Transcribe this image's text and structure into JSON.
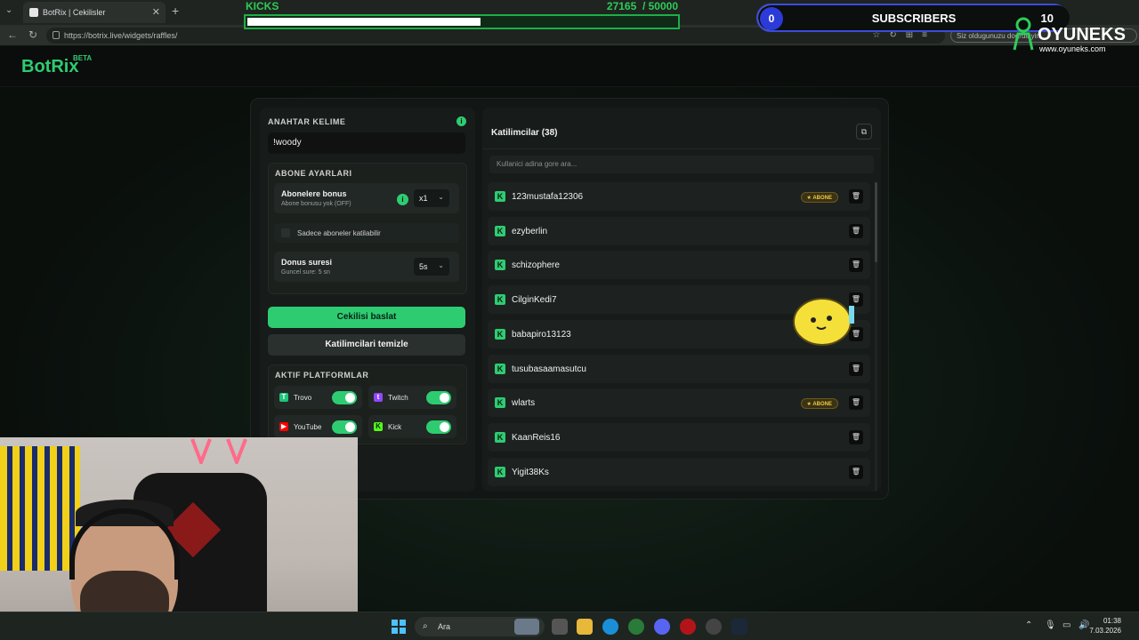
{
  "browser": {
    "tab_title": "BotRix | Cekilisler",
    "new_tab": "+",
    "close": "✕",
    "url": "https://botrix.live/widgets/raffles/",
    "signin_notice": "Siz oldugunuzu dogrulayin..."
  },
  "overlay": {
    "kicks_label": "KICKS",
    "kicks_count": "27165",
    "kicks_goal": "/ 50000",
    "kicks_progress": 0.54,
    "subs_count": "0",
    "subs_label": "SUBSCRIBERS",
    "subs_goal": "10",
    "watermark": "OYUNEKS",
    "watermark_url": "www.oyuneks.com"
  },
  "app": {
    "brand": "BotRix",
    "beta": "BETA"
  },
  "settings": {
    "keyword_label": "ANAHTAR KELIME",
    "keyword_value": "!woody",
    "sub_section_title": "ABONE AYARLARI",
    "sub_bonus_title": "Abonelere bonus",
    "sub_bonus_sub": "Abone bonusu yok (OFF)",
    "sub_bonus_value": "x1",
    "subs_only_label": "Sadece aboneler katilabilir",
    "duration_title": "Donus suresi",
    "duration_sub": "Guncel sure: 5 sn",
    "duration_value": "5s",
    "start_button": "Cekilisi baslat",
    "clear_button": "Katilimcilari temizle",
    "platforms_title": "AKTIF PLATFORMLAR",
    "platforms": [
      {
        "name": "Trovo",
        "enabled": true,
        "color": "#1ec47a"
      },
      {
        "name": "Twitch",
        "enabled": true,
        "color": "#9146ff"
      },
      {
        "name": "YouTube",
        "enabled": true,
        "color": "#ff0000"
      },
      {
        "name": "Kick",
        "enabled": true,
        "color": "#53fc18"
      }
    ]
  },
  "participants": {
    "title": "Katilimcilar (38)",
    "search_placeholder": "Kullanici adina gore ara...",
    "badge_label": "ABONE",
    "items": [
      {
        "name": "123mustafa12306",
        "subscriber": true
      },
      {
        "name": "ezyberlin",
        "subscriber": false
      },
      {
        "name": "schizophere",
        "subscriber": false
      },
      {
        "name": "CilginKedi7",
        "subscriber": false
      },
      {
        "name": "babapiro13123",
        "subscriber": false
      },
      {
        "name": "tusubasaamasutcu",
        "subscriber": false
      },
      {
        "name": "wlarts",
        "subscriber": true
      },
      {
        "name": "KaanReis16",
        "subscriber": false
      },
      {
        "name": "Yigit38Ks",
        "subscriber": false
      }
    ]
  },
  "taskbar": {
    "search": "Ara",
    "time": "01:38",
    "date": "7.03.2026"
  },
  "colors": {
    "accent": "#2ecc71",
    "kick_green": "#2ecc58",
    "subs_blue": "#2c3ad8",
    "badge_gold": "#f0c83c"
  }
}
